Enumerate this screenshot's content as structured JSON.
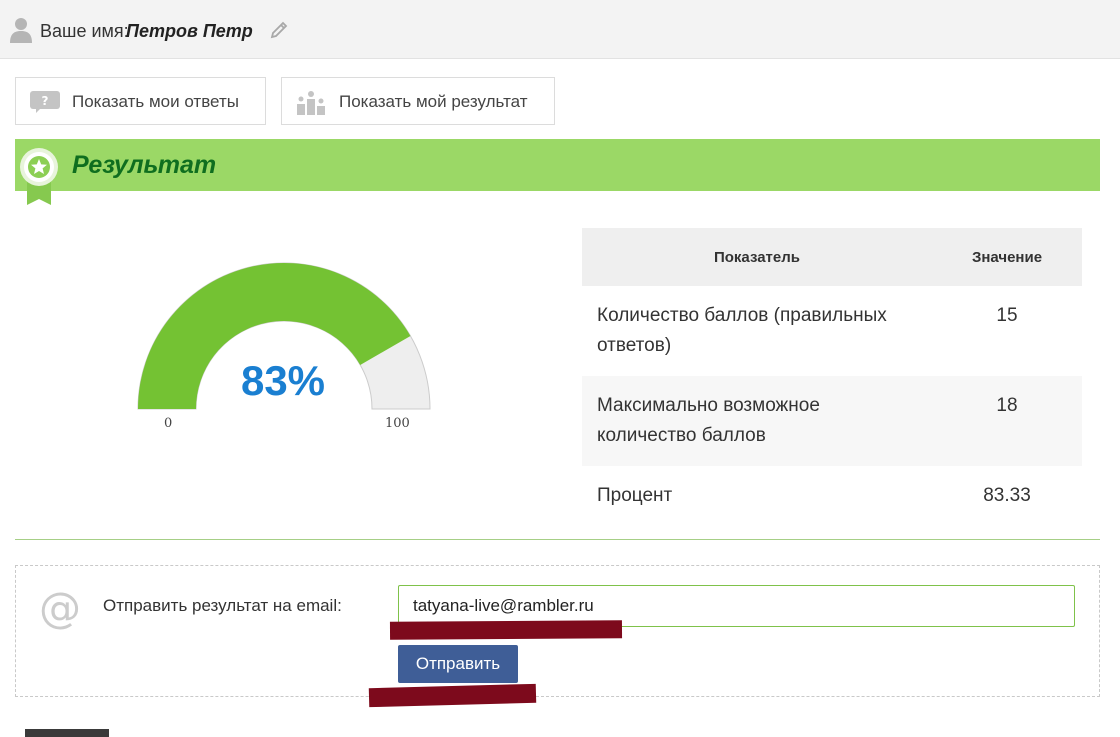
{
  "header": {
    "name_label": "Ваше имя:",
    "name_value": "Петров Петр",
    "icons": {
      "user": "user-icon",
      "edit": "pencil-icon"
    }
  },
  "toolbar": {
    "show_answers_label": "Показать мои ответы",
    "show_answers_icon": "question-bubble-icon",
    "show_result_label": "Показать мой результат",
    "show_result_icon": "podium-icon"
  },
  "result": {
    "title": "Результат",
    "icon": "award-icon",
    "accent_color": "#9bd866",
    "title_color": "#0f6e1f"
  },
  "gauge": {
    "percent_label": "83%",
    "value": 83.33,
    "min_label": "0",
    "max_label": "100",
    "fill_color": "#74c233",
    "track_color": "#eeeeee",
    "text_color": "#1a7fd1"
  },
  "table": {
    "headers": [
      "Показатель",
      "Значение"
    ],
    "rows": [
      {
        "label": "Количество баллов (правильных ответов)",
        "value": "15"
      },
      {
        "label": "Максимально возможное количество баллов",
        "value": "18"
      },
      {
        "label": "Процент",
        "value": "83.33"
      }
    ]
  },
  "email": {
    "label": "Отправить результат на email:",
    "value": "tatyana-live@rambler.ru",
    "send_label": "Отправить",
    "icon": "at-icon",
    "button_color": "#3f5e97"
  }
}
